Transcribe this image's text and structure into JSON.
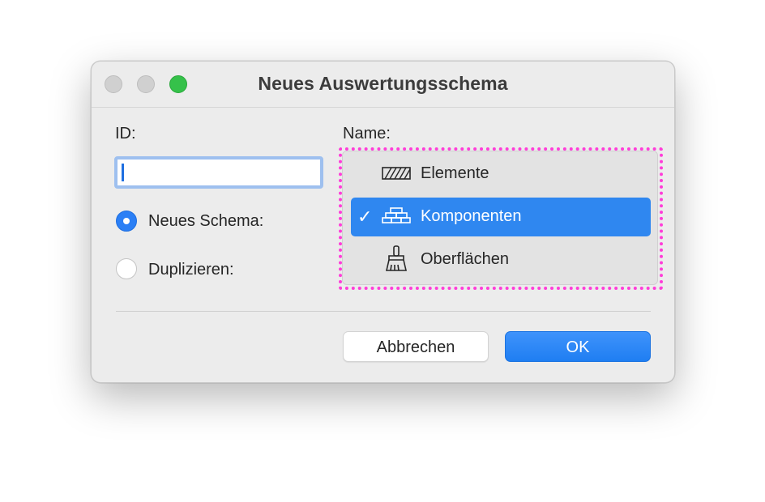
{
  "dialog": {
    "title": "Neues Auswertungsschema"
  },
  "form": {
    "id_label": "ID:",
    "id_value": "",
    "name_label": "Name:",
    "radio_new_label": "Neues Schema:",
    "radio_duplicate_label": "Duplizieren:",
    "selected_radio": "Neues Schema:"
  },
  "name_menu": {
    "items": [
      {
        "label": "Elemente",
        "icon": "hatched-element-icon",
        "selected": false
      },
      {
        "label": "Komponenten",
        "icon": "brick-wall-icon",
        "selected": true
      },
      {
        "label": "Oberflächen",
        "icon": "paint-brush-icon",
        "selected": false
      }
    ],
    "check_glyph": "✓",
    "selected_color": "#2f87f0"
  },
  "buttons": {
    "cancel_label": "Abbrechen",
    "ok_label": "OK"
  },
  "colors": {
    "accent": "#2b7ff5",
    "highlight_frame": "#ff3dd8",
    "traffic_zoom": "#35c14a"
  }
}
